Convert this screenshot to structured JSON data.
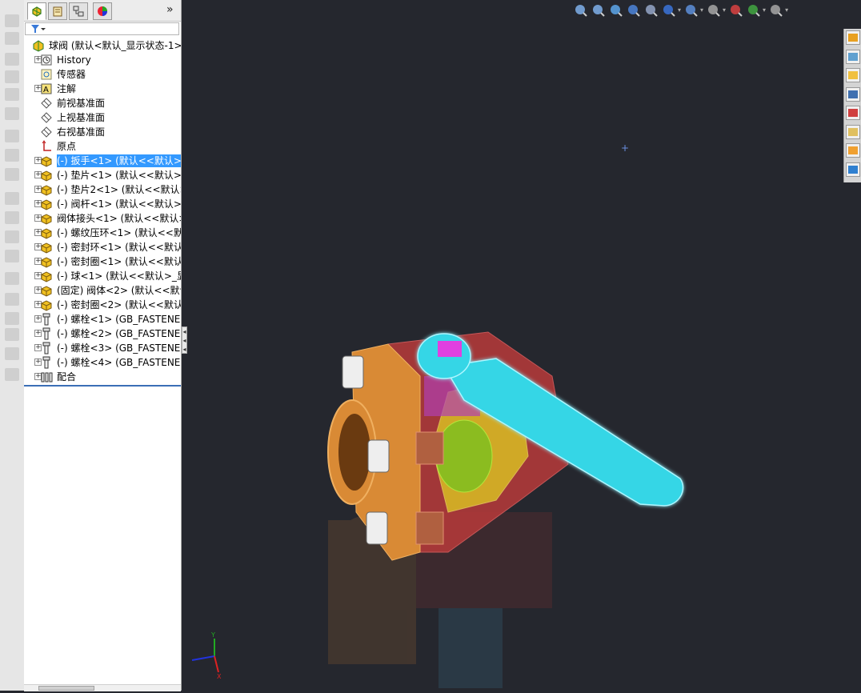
{
  "feature_tree": {
    "tabs": [
      {
        "icon": "feature-manager-icon",
        "active": true
      },
      {
        "icon": "property-manager-icon",
        "active": false
      },
      {
        "icon": "configuration-manager-icon",
        "active": false
      },
      {
        "icon": "display-manager-icon",
        "active": false
      }
    ],
    "overflow_label": "»",
    "items": [
      {
        "label": "球阀  (默认<默认_显示状态-1>)",
        "icon": "assembly-icon",
        "expander": "",
        "level": 0
      },
      {
        "label": "History",
        "icon": "history-icon",
        "expander": "+",
        "level": 1
      },
      {
        "label": "传感器",
        "icon": "sensor-icon",
        "expander": "",
        "level": 1
      },
      {
        "label": "注解",
        "icon": "annotation-icon",
        "expander": "+",
        "level": 1
      },
      {
        "label": "前视基准面",
        "icon": "plane-icon",
        "expander": "",
        "level": 1
      },
      {
        "label": "上视基准面",
        "icon": "plane-icon",
        "expander": "",
        "level": 1
      },
      {
        "label": "右视基准面",
        "icon": "plane-icon",
        "expander": "",
        "level": 1
      },
      {
        "label": "原点",
        "icon": "origin-icon",
        "expander": "",
        "level": 1
      },
      {
        "label": "(-) 扳手<1> (默认<<默认>_",
        "icon": "part-icon",
        "expander": "+",
        "level": 1,
        "selected": true
      },
      {
        "label": "(-) 垫片<1> (默认<<默认>_",
        "icon": "part-icon",
        "expander": "+",
        "level": 1
      },
      {
        "label": "(-) 垫片2<1> (默认<<默认>",
        "icon": "part-icon",
        "expander": "+",
        "level": 1
      },
      {
        "label": "(-) 阀杆<1> (默认<<默认>_",
        "icon": "part-icon",
        "expander": "+",
        "level": 1
      },
      {
        "label": "阀体接头<1> (默认<<默认>",
        "icon": "part-icon",
        "expander": "+",
        "level": 1
      },
      {
        "label": "(-) 螺纹压环<1> (默认<<默",
        "icon": "part-icon",
        "expander": "+",
        "level": 1
      },
      {
        "label": "(-) 密封环<1> (默认<<默认",
        "icon": "part-icon",
        "expander": "+",
        "level": 1
      },
      {
        "label": "(-) 密封圈<1> (默认<<默认",
        "icon": "part-icon",
        "expander": "+",
        "level": 1
      },
      {
        "label": "(-) 球<1> (默认<<默认>_显",
        "icon": "part-icon",
        "expander": "+",
        "level": 1
      },
      {
        "label": "(固定) 阀体<2> (默认<<默认",
        "icon": "part-icon",
        "expander": "+",
        "level": 1
      },
      {
        "label": "(-) 密封圈<2> (默认<<默认",
        "icon": "part-icon",
        "expander": "+",
        "level": 1
      },
      {
        "label": "(-) 螺栓<1> (GB_FASTENER",
        "icon": "bolt-icon",
        "expander": "+",
        "level": 1
      },
      {
        "label": "(-) 螺栓<2> (GB_FASTENER",
        "icon": "bolt-icon",
        "expander": "+",
        "level": 1
      },
      {
        "label": "(-) 螺栓<3> (GB_FASTENER",
        "icon": "bolt-icon",
        "expander": "+",
        "level": 1
      },
      {
        "label": "(-) 螺栓<4> (GB_FASTENER",
        "icon": "bolt-icon",
        "expander": "+",
        "level": 1
      },
      {
        "label": "配合",
        "icon": "mates-icon",
        "expander": "+",
        "level": 1
      }
    ]
  },
  "heads_up_toolbar": [
    {
      "icon": "zoom-to-fit-icon"
    },
    {
      "icon": "zoom-to-area-icon"
    },
    {
      "icon": "previous-view-icon"
    },
    {
      "icon": "section-view-icon"
    },
    {
      "icon": "dynamic-annotation-icon"
    },
    {
      "icon": "view-orientation-icon",
      "dropdown": true
    },
    {
      "icon": "display-style-icon",
      "dropdown": true
    },
    {
      "icon": "hide-show-items-icon",
      "dropdown": true
    },
    {
      "icon": "edit-appearance-icon"
    },
    {
      "icon": "apply-scene-icon",
      "dropdown": true
    },
    {
      "icon": "view-settings-icon",
      "dropdown": true
    }
  ],
  "task_pane": [
    {
      "icon": "home-icon"
    },
    {
      "icon": "design-library-icon"
    },
    {
      "icon": "file-explorer-icon"
    },
    {
      "icon": "view-palette-icon"
    },
    {
      "icon": "appearances-icon"
    },
    {
      "icon": "custom-properties-icon"
    },
    {
      "icon": "recent-documents-icon"
    },
    {
      "icon": "forum-icon"
    }
  ],
  "colors": {
    "viewport_bg": "#25272e",
    "selection": "#3399ff",
    "handle": "#35d6e6",
    "flange": "#d98a35",
    "body": "#b83a3a",
    "ball": "#e0d020"
  }
}
